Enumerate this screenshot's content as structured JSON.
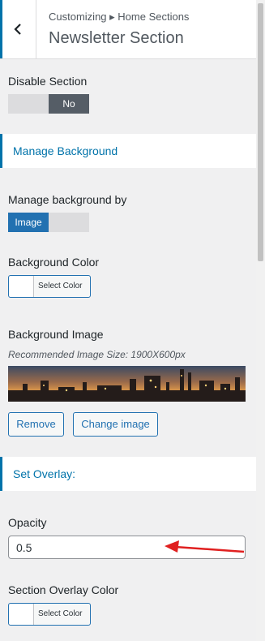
{
  "header": {
    "breadcrumb": "Customizing ▸ Home Sections",
    "title": "Newsletter Section"
  },
  "disable_section": {
    "label": "Disable Section",
    "value": "No"
  },
  "manage_background_heading": "Manage Background",
  "manage_background_by": {
    "label": "Manage background by",
    "value": "Image"
  },
  "background_color": {
    "label": "Background Color",
    "button": "Select Color"
  },
  "background_image": {
    "label": "Background Image",
    "description": "Recommended Image Size: 1900X600px",
    "remove_button": "Remove",
    "change_button": "Change image"
  },
  "set_overlay_heading": "Set Overlay:",
  "opacity": {
    "label": "Opacity",
    "value": "0.5"
  },
  "overlay_color": {
    "label": "Section Overlay Color",
    "button": "Select Color"
  },
  "colors": {
    "accent": "#0073aa",
    "button_blue": "#2271b1",
    "toggle_off": "#555d66",
    "arrow": "#e02020"
  }
}
